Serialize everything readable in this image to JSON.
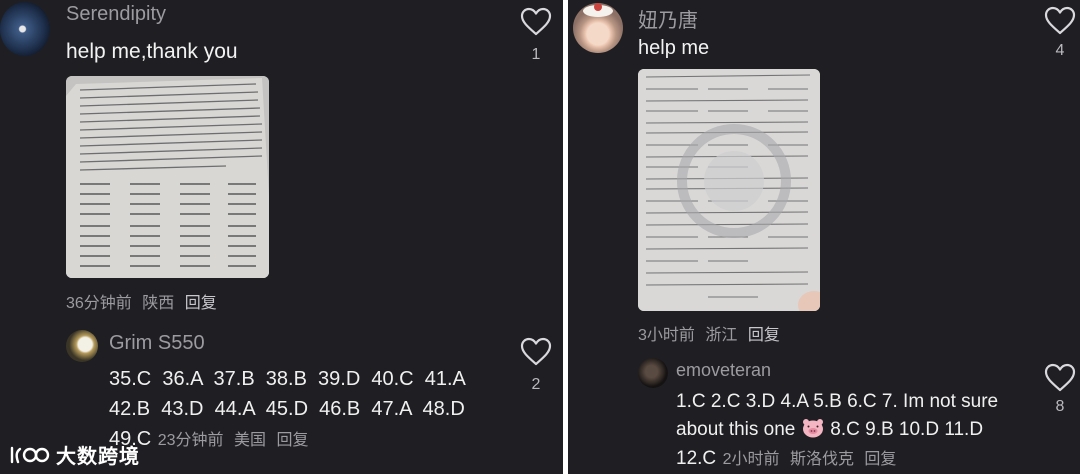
{
  "left": {
    "comment": {
      "username": "Serendipity",
      "text": "help me,thank you",
      "meta_time": "36分钟前",
      "meta_location": "陕西",
      "reply_label": "回复",
      "likes": "1"
    },
    "reply": {
      "username": "Grim S550",
      "line1": "35.C  36.A  37.B  38.B  39.D  40.C  41.A",
      "line2": "42.B  43.D  44.A  45.D  46.B  47.A  48.D",
      "line3_start": "49.C",
      "meta_time": "23分钟前",
      "meta_location": "美国",
      "reply_label": "回复",
      "likes": "2"
    }
  },
  "right": {
    "comment": {
      "username": "妞乃唐",
      "text": "help me",
      "meta_time": "3小时前",
      "meta_location": "浙江",
      "reply_label": "回复",
      "likes": "4"
    },
    "reply": {
      "username": "emoveteran",
      "line1": "1.C 2.C 3.D 4.A 5.B 6.C 7. Im not sure",
      "line2_a": "about this one",
      "line2_b": "8.C 9.B 10.D 11.D",
      "line3_start": "12.C",
      "meta_time": "2小时前",
      "meta_location": "斯洛伐克",
      "reply_label": "回复",
      "likes": "8"
    }
  },
  "watermark": {
    "text": "大数跨境"
  },
  "colors": {
    "background": "#1f1f23",
    "text": "#f2f2f2",
    "muted": "#9b9ba0"
  }
}
